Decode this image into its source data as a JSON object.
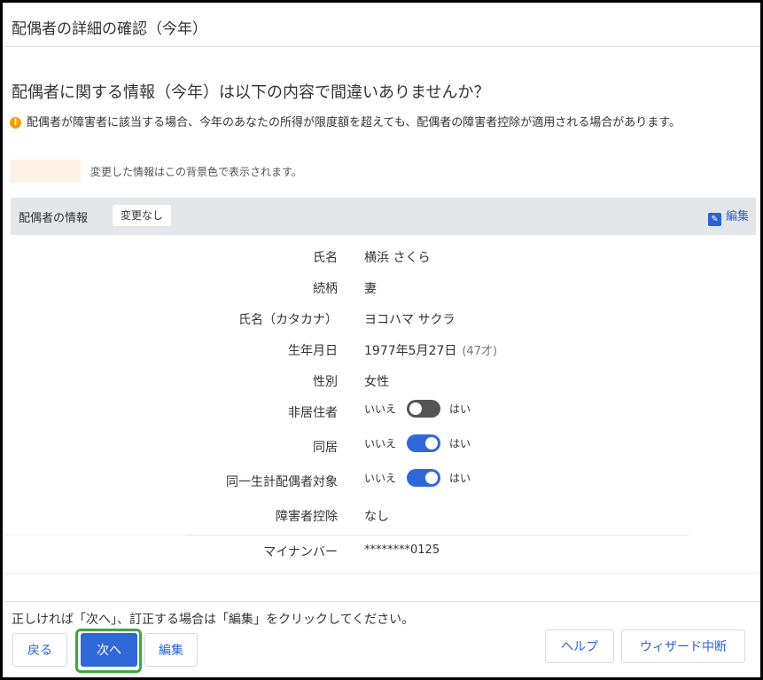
{
  "dialog": {
    "title": "配偶者の詳細の確認（今年）",
    "question": "配偶者に関する情報（今年）は以下の内容で間違いありませんか？",
    "notice": "配偶者が障害者に該当する場合、今年のあなたの所得が限度額を超えても、配偶者の障害者控除が適用される場合があります。",
    "notice_icon": "info-icon",
    "legend_text": "変更した情報はこの背景色で表示されます。",
    "legend_color": "#fdf0e4"
  },
  "section": {
    "title": "配偶者の情報",
    "status": "変更なし",
    "edit_label": "編集"
  },
  "fields": {
    "name": {
      "label": "氏名",
      "value": "横浜 さくら"
    },
    "relation": {
      "label": "続柄",
      "value": "妻"
    },
    "kana": {
      "label": "氏名（カタカナ）",
      "value": "ヨコハマ サクラ"
    },
    "birthday": {
      "label": "生年月日",
      "value": "1977年5月27日",
      "age": "(47才)"
    },
    "gender": {
      "label": "性別",
      "value": "女性"
    },
    "nonresident": {
      "label": "非居住者",
      "no": "いいえ",
      "yes": "はい",
      "state": "off"
    },
    "cohabit": {
      "label": "同居",
      "no": "いいえ",
      "yes": "はい",
      "state": "on"
    },
    "same_household": {
      "label": "同一生計配偶者対象",
      "no": "いいえ",
      "yes": "はい",
      "state": "on"
    },
    "disability": {
      "label": "障害者控除",
      "value": "なし"
    },
    "mynumber": {
      "label": "マイナンバー",
      "value": "********0125"
    }
  },
  "footer": {
    "message": "正しければ「次へ」、訂正する場合は「編集」をクリックしてください。",
    "back": "戻る",
    "next": "次へ",
    "edit": "編集",
    "help": "ヘルプ",
    "abort": "ウィザード中断"
  },
  "colors": {
    "accent": "#2f68d8",
    "focus_ring": "#3aaa3a",
    "notice": "#f0a000",
    "toggle_off": "#555555"
  }
}
